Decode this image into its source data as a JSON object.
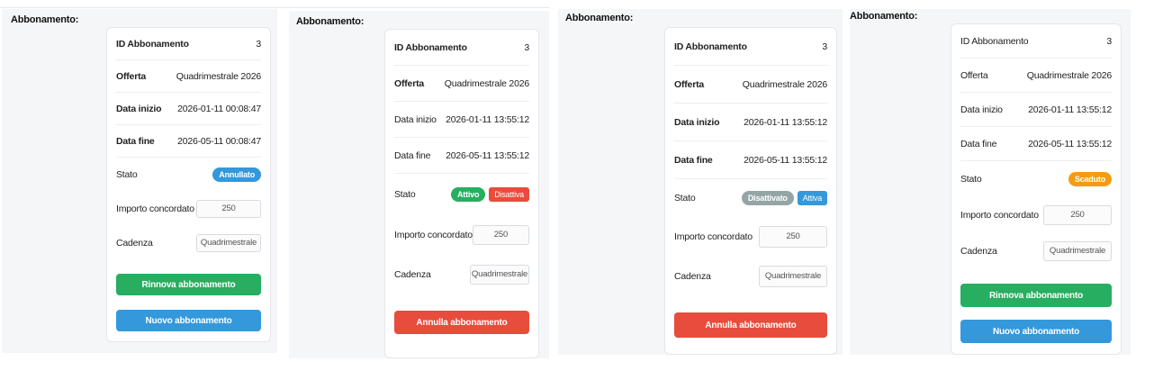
{
  "colors": {
    "green": "#27ae60",
    "blue": "#3498db",
    "red": "#e74c3c",
    "orange": "#f39c12",
    "grey": "#95a5a6"
  },
  "panels": [
    {
      "heading": "Abbonamento:",
      "id_label": "ID Abbonamento",
      "id_value": "3",
      "offer_label": "Offerta",
      "offer_value": "Quadrimestrale 2026",
      "start_label": "Data inizio",
      "start_value": "2026-01-11 00:08:47",
      "end_label": "Data fine",
      "end_value": "2026-05-11 00:08:47",
      "status_label": "Stato",
      "status_badge": "Annullato",
      "amount_label": "Importo concordato",
      "amount_value": "250",
      "cadence_label": "Cadenza",
      "cadence_value": "Quadrimestrale",
      "renew_button": "Rinnova abbonamento",
      "new_button": "Nuovo abbonamento"
    },
    {
      "heading": "Abbonamento:",
      "id_label": "ID Abbonamento",
      "id_value": "3",
      "offer_label": "Offerta",
      "offer_value": "Quadrimestrale 2026",
      "start_label": "Data inizio",
      "start_value": "2026-01-11 13:55:12",
      "end_label": "Data fine",
      "end_value": "2026-05-11 13:55:12",
      "status_label": "Stato",
      "status_badge": "Attivo",
      "status_action": "Disattiva",
      "amount_label": "Importo concordato",
      "amount_value": "250",
      "cadence_label": "Cadenza",
      "cadence_value": "Quadrimestrale",
      "cancel_button": "Annulla abbonamento"
    },
    {
      "heading": "Abbonamento:",
      "id_label": "ID Abbonamento",
      "id_value": "3",
      "offer_label": "Offerta",
      "offer_value": "Quadrimestrale 2026",
      "start_label": "Data inizio",
      "start_value": "2026-01-11 13:55:12",
      "end_label": "Data fine",
      "end_value": "2026-05-11 13:55:12",
      "status_label": "Stato",
      "status_badge": "Disattivato",
      "status_action": "Attiva",
      "amount_label": "Importo concordato",
      "amount_value": "250",
      "cadence_label": "Cadenza",
      "cadence_value": "Quadrimestrale",
      "cancel_button": "Annulla abbonamento"
    },
    {
      "heading": "Abbonamento:",
      "id_label": "ID Abbonamento",
      "id_value": "3",
      "offer_label": "Offerta",
      "offer_value": "Quadrimestrale 2026",
      "start_label": "Data inizio",
      "start_value": "2026-01-11 13:55:12",
      "end_label": "Data fine",
      "end_value": "2026-05-11 13:55:12",
      "status_label": "Stato",
      "status_badge": "Scaduto",
      "amount_label": "Importo concordato",
      "amount_value": "250",
      "cadence_label": "Cadenza",
      "cadence_value": "Quadrimestrale",
      "renew_button": "Rinnova abbonamento",
      "new_button": "Nuovo abbonamento"
    }
  ]
}
